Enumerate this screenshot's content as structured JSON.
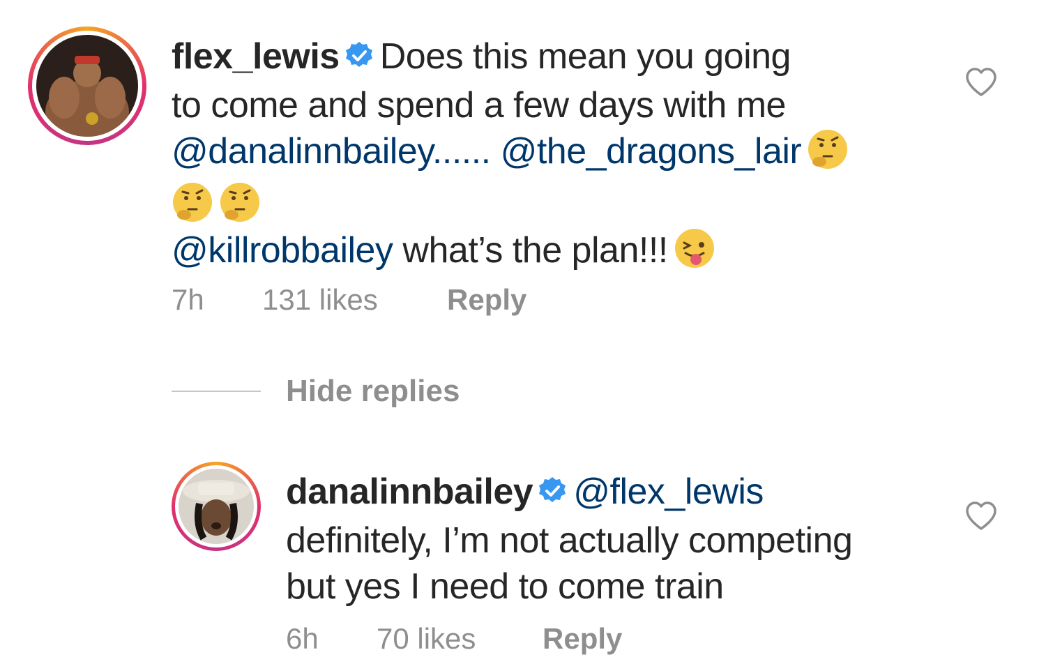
{
  "comments": [
    {
      "username": "flex_lewis",
      "text_line1": "Does this mean you going",
      "text_line2": "to come and spend a few days with me",
      "mention1": "@danalinnbailey......",
      "mention2": "@the_dragons_lair",
      "mention3": "@killrobbailey",
      "text_line5": "what’s the plan!!!",
      "time": "7h",
      "likes": "131 likes",
      "reply": "Reply",
      "emojis": [
        "thinking-face",
        "thinking-face",
        "thinking-face",
        "winking-tongue-face"
      ]
    },
    {
      "username": "danalinnbailey",
      "mention": "@flex_lewis",
      "text_line2": "definitely, I’m not actually competing",
      "text_line3": "but yes I need to come train",
      "time": "6h",
      "likes": "70 likes",
      "reply": "Reply"
    }
  ],
  "hide_replies": "Hide replies",
  "colors": {
    "text": "#262626",
    "mention": "#00376b",
    "meta": "#8e8e8e",
    "verified": "#3897f0"
  }
}
